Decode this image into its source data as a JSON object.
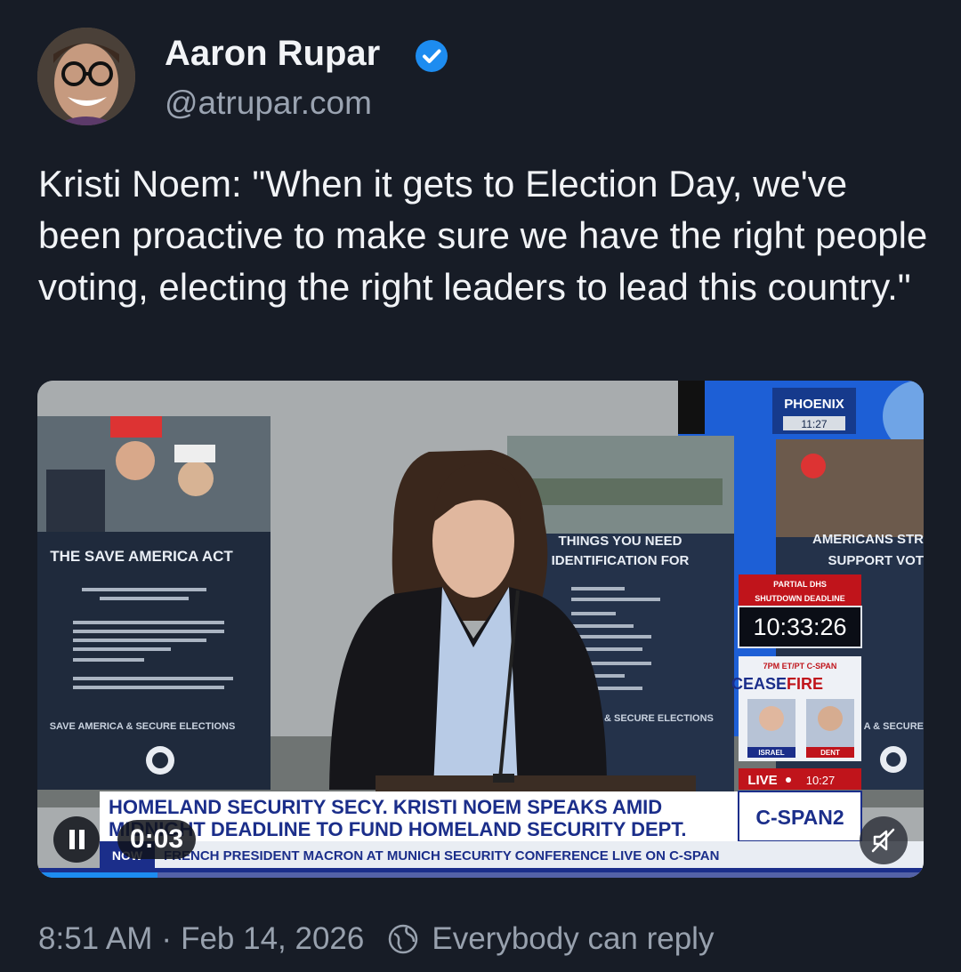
{
  "post": {
    "author_name": "Aaron Rupar",
    "handle": "@atrupar.com",
    "text": "Kristi Noem: \"When it gets to Election Day, we've been proactive to make sure we have the right people voting, electing the right leaders to lead this country.\"",
    "time": "8:51 AM",
    "separator": "·",
    "date": "Feb 14, 2026",
    "reply_setting": "Everybody can reply"
  },
  "video": {
    "elapsed": "0:03",
    "poster_left": {
      "title": "THE SAVE AMERICA ACT",
      "footer": "SAVE AMERICA & SECURE ELECTIONS"
    },
    "poster_center": {
      "title_line1": "THINGS YOU NEED",
      "title_line2": "IDENTIFICATION FOR",
      "footer": "ERICA & SECURE ELECTIONS"
    },
    "poster_right": {
      "title_line1": "AMERICANS STR",
      "title_line2": "SUPPORT VOT",
      "footer": "A & SECURE"
    },
    "location": "PHOENIX",
    "location_time": "11:27",
    "deadline_label_line1": "PARTIAL DHS",
    "deadline_label_line2": "SHUTDOWN DEADLINE",
    "countdown": "10:33:26",
    "promo_time": "7PM ET/PT C-SPAN",
    "promo_title_a": "CEASE",
    "promo_title_b": "FIRE",
    "promo_label_left": "ISRAEL",
    "promo_label_right": "DENT",
    "live_label": "LIVE",
    "live_time": "10:27",
    "headline_line1": "HOMELAND SECURITY SECY. KRISTI NOEM SPEAKS AMID",
    "headline_line2": "MIDNIGHT DEADLINE TO FUND HOMELAND SECURITY DEPT.",
    "network": "C-SPAN2",
    "ticker_prefix": "NOW",
    "ticker": "FRENCH PRESIDENT MACRON AT MUNICH SECURITY CONFERENCE  LIVE ON C-SPAN"
  },
  "colors": {
    "background": "#171c26",
    "verified": "#1d8cf0",
    "cspan_blue": "#1b2e8a",
    "deadline_red": "#c0141b"
  },
  "icons": [
    "verified-badge-icon",
    "pause-icon",
    "mute-icon",
    "globe-icon"
  ]
}
